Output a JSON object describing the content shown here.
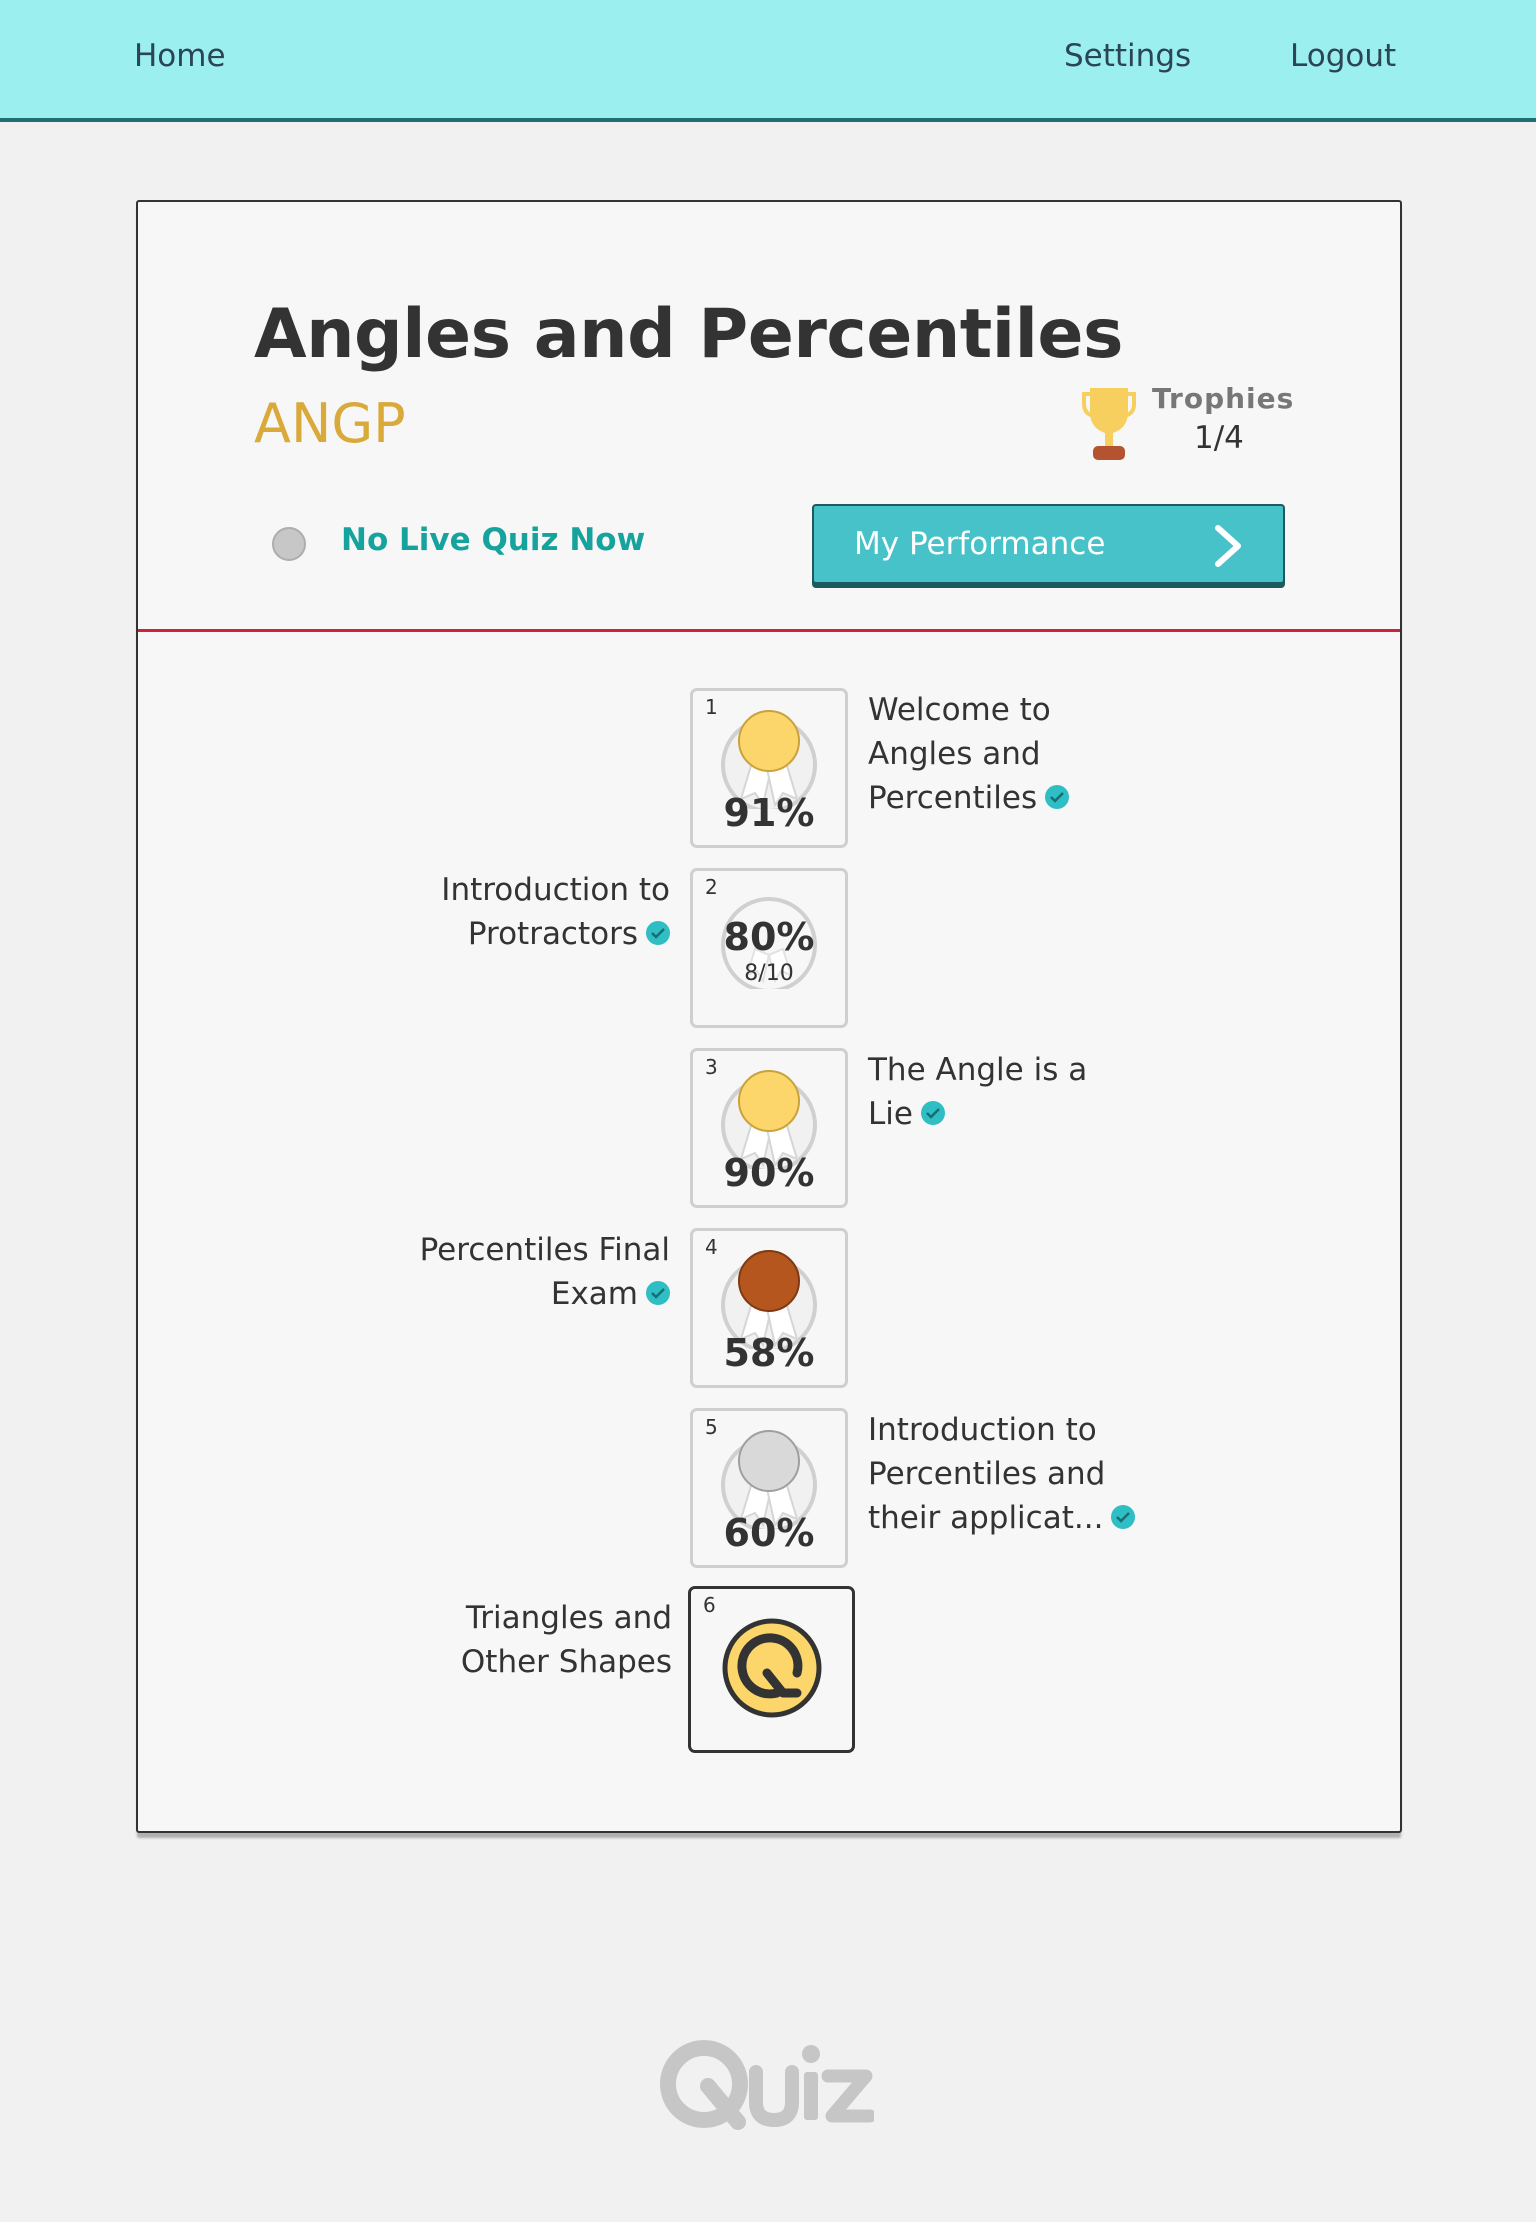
{
  "nav": {
    "home": "Home",
    "settings": "Settings",
    "logout": "Logout"
  },
  "course": {
    "title": "Angles and Percentiles",
    "code": "ANGP"
  },
  "trophies": {
    "label": "Trophies",
    "count": "1/4"
  },
  "live": {
    "status": "No Live Quiz Now"
  },
  "performance_button": {
    "label": "My Performance"
  },
  "quizzes": [
    {
      "number": "1",
      "name": "Welcome to Angles and Percentiles",
      "score": "91%",
      "medal": "gold",
      "completed": true
    },
    {
      "number": "2",
      "name": "Introduction to Protractors",
      "score": "80%",
      "detail": "8/10",
      "medal": "none",
      "completed": true
    },
    {
      "number": "3",
      "name": "The Angle is a Lie",
      "score": "90%",
      "medal": "gold",
      "completed": true
    },
    {
      "number": "4",
      "name": "Percentiles Final Exam",
      "score": "58%",
      "medal": "bronze",
      "completed": true
    },
    {
      "number": "5",
      "name": "Introduction to Percentiles and their applicat...",
      "score": "60%",
      "medal": "silver",
      "completed": true
    },
    {
      "number": "6",
      "name": "Triangles and Other Shapes",
      "medal": "quiz-logo",
      "completed": false
    }
  ],
  "colors": {
    "nav_bg": "#9bf0ef",
    "accent_teal": "#47c2c8",
    "code_gold": "#d9a93a",
    "divider_red": "#c9243a",
    "check_teal": "#2fbec4"
  },
  "footer": {
    "logo_icon": "quiz-logo-icon"
  }
}
